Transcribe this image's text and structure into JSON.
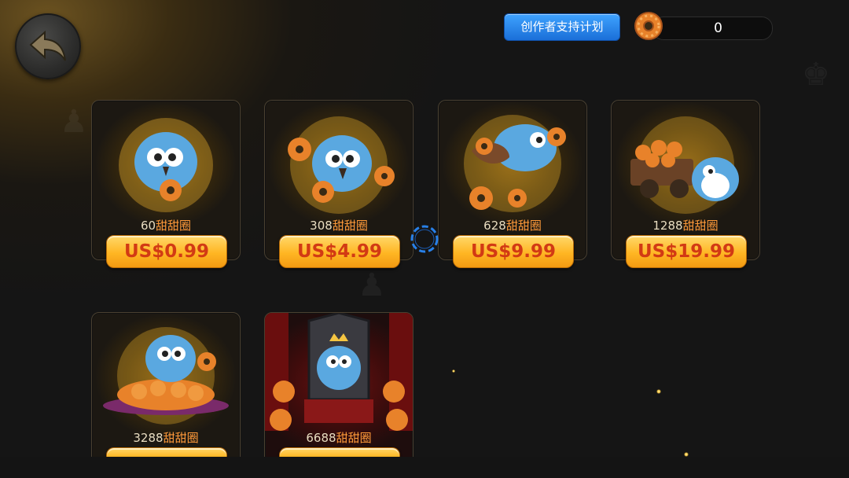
{
  "header": {
    "creator_button_label": "创作者支持计划",
    "currency_value": "0",
    "currency_icon": "donut-icon"
  },
  "navigation": {
    "back_icon": "back-arrow-icon"
  },
  "shop": {
    "items": [
      {
        "amount": "60",
        "unit": "甜甜圈",
        "price": "US$0.99",
        "art": "bird-holding-donut"
      },
      {
        "amount": "308",
        "unit": "甜甜圈",
        "price": "US$4.99",
        "art": "bird-with-donuts"
      },
      {
        "amount": "628",
        "unit": "甜甜圈",
        "price": "US$9.99",
        "art": "bird-with-donut-bag"
      },
      {
        "amount": "1288",
        "unit": "甜甜圈",
        "price": "US$19.99",
        "art": "bird-with-donut-cart"
      },
      {
        "amount": "3288",
        "unit": "甜甜圈",
        "price": "",
        "art": "bird-on-donut-pile"
      },
      {
        "amount": "6688",
        "unit": "甜甜圈",
        "price": "",
        "art": "bird-king-on-throne"
      }
    ]
  },
  "colors": {
    "price_text": "#d23a14",
    "price_button": "#ffb623",
    "unit_text": "#ff9a3a",
    "creator_button": "#1a6fd8"
  }
}
